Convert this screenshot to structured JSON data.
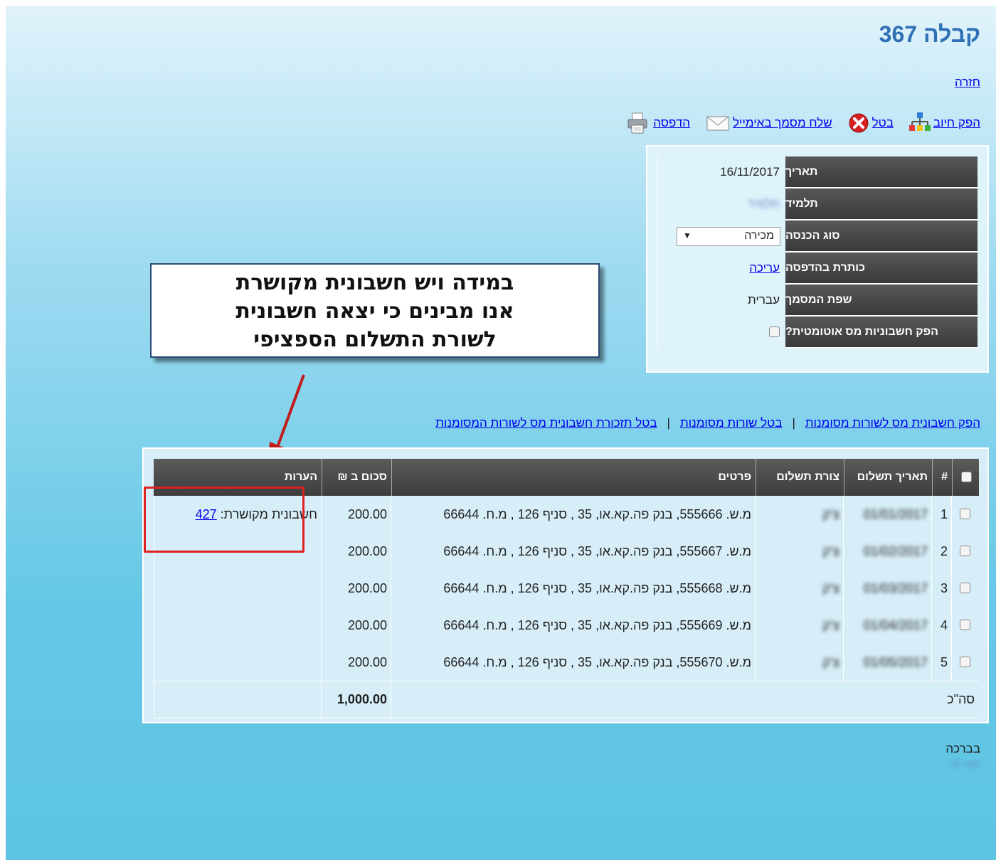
{
  "page": {
    "title": "קבלה 367",
    "back_link": "חזרה"
  },
  "toolbar": {
    "print": {
      "label": "הדפסה",
      "icon": "printer-icon"
    },
    "email": {
      "label": "שלח מסמך באימייל",
      "icon": "envelope-icon"
    },
    "cancel": {
      "label": "בטל",
      "icon": "cancel-x-icon"
    },
    "charge": {
      "label": "הפק חיוב",
      "icon": "sitemap-icon"
    }
  },
  "info": {
    "date_label": "תאריך",
    "date_value": "16/11/2017",
    "student_label": "תלמיד",
    "student_value": "תלמיד",
    "income_type_label": "סוג הכנסה",
    "income_type_value": "מכירה",
    "print_title_label": "כותרת בהדפסה",
    "print_title_link": "עריכה",
    "language_label": "שפת המסמך",
    "language_value": "עברית",
    "auto_tax_label": "הפק חשבוניות מס אוטומטית?",
    "auto_tax_checked": false
  },
  "callout": {
    "line1": "במידה ויש חשבונית מקושרת",
    "line2": "אנו מבינים כי יצאה חשבונית",
    "line3": "לשורת התשלום הספציפי"
  },
  "actions": {
    "issue_tax_invoice": "הפק חשבונית מס לשורות מסומנות",
    "separator": "|",
    "cancel_rows": "בטל שורות מסומנות",
    "cancel_tax_invoice_credit": "בטל תזכורת חשבונית מס לשורות המסומנות"
  },
  "table": {
    "headers": {
      "num": "#",
      "payment_date": "תאריך תשלום",
      "payment_method": "צורת תשלום",
      "details": "פרטים",
      "amount": "סכום ב ₪",
      "notes": "הערות"
    },
    "rows": [
      {
        "num": "1",
        "payment_date": "01/01/2017",
        "payment_method": "צ'ק",
        "details": "מ.ש. 555666, בנק פה.קא.או, 35 , סניף 126 , מ.ח. 66644",
        "amount": "200.00",
        "note_label": "חשבונית מקושרת:",
        "note_link": "427"
      },
      {
        "num": "2",
        "payment_date": "01/02/2017",
        "payment_method": "צ'ק",
        "details": "מ.ש. 555667, בנק פה.קא.או, 35 , סניף 126 , מ.ח. 66644",
        "amount": "200.00",
        "note_label": "",
        "note_link": ""
      },
      {
        "num": "3",
        "payment_date": "01/03/2017",
        "payment_method": "צ'ק",
        "details": "מ.ש. 555668, בנק פה.קא.או, 35 , סניף 126 , מ.ח. 66644",
        "amount": "200.00",
        "note_label": "",
        "note_link": ""
      },
      {
        "num": "4",
        "payment_date": "01/04/2017",
        "payment_method": "צ'ק",
        "details": "מ.ש. 555669, בנק פה.קא.או, 35 , סניף 126 , מ.ח. 66644",
        "amount": "200.00",
        "note_label": "",
        "note_link": ""
      },
      {
        "num": "5",
        "payment_date": "01/05/2017",
        "payment_method": "צ'ק",
        "details": "מ.ש. 555670, בנק פה.קא.או, 35 , סניף 126 , מ.ח. 66644",
        "amount": "200.00",
        "note_label": "",
        "note_link": ""
      }
    ],
    "total_label": "סה\"כ",
    "total_value": "1,000.00"
  },
  "footer": {
    "greeting": "בברכה",
    "signature": "חנה לוי"
  },
  "colors": {
    "title": "#2e6fb5",
    "link": "#0000ee",
    "header_bg": "#3d3d3d",
    "highlight_frame": "#dd2222",
    "arrow": "#c11b1b"
  }
}
